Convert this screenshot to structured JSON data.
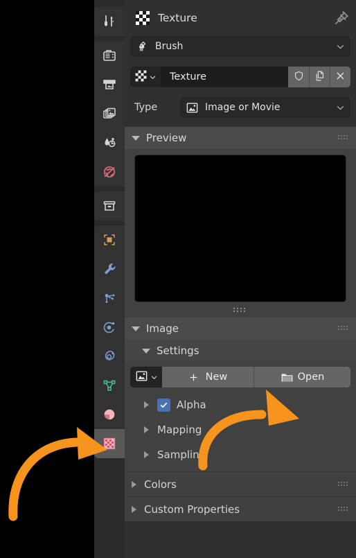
{
  "app": {
    "editor_name": "properties-editor",
    "accent_orange": "#F7941E",
    "panel_bg": "#414141",
    "header_bg": "#4a4a4a",
    "tab_bg": "#323232",
    "tab_active_bg": "#585858",
    "field_bg": "#282828",
    "button_bg": "#656565",
    "checkbox_blue": "#4772b3"
  },
  "tabs": [
    {
      "name": "tool",
      "icon": "tool-icon",
      "color": "#d4d4d4",
      "active": false
    },
    {
      "name": "render",
      "icon": "camera-back-icon",
      "color": "#d4d4d4",
      "active": false
    },
    {
      "name": "output",
      "icon": "printer-icon",
      "color": "#d4d4d4",
      "active": false
    },
    {
      "name": "view-layer",
      "icon": "images-stack-icon",
      "color": "#d4d4d4",
      "active": false
    },
    {
      "name": "scene",
      "icon": "scene-cone-icon",
      "color": "#d4d4d4",
      "active": false
    },
    {
      "name": "world",
      "icon": "world-globe-icon",
      "color": "#d96a7e",
      "active": false
    },
    {
      "name": "collection",
      "icon": "box-icon",
      "color": "#d4d4d4",
      "active": false
    },
    {
      "name": "object",
      "icon": "object-square-icon",
      "color": "#d99b57",
      "active": false
    },
    {
      "name": "modifiers",
      "icon": "wrench-icon",
      "color": "#7d9fd4",
      "active": false
    },
    {
      "name": "particles",
      "icon": "particles-icon",
      "color": "#7d9fd4",
      "active": false
    },
    {
      "name": "physics",
      "icon": "physics-orbit-icon",
      "color": "#7d9fd4",
      "active": false
    },
    {
      "name": "object-constraints",
      "icon": "constraint-icon",
      "color": "#7d9fd4",
      "active": false
    },
    {
      "name": "object-data",
      "icon": "mesh-data-icon",
      "color": "#46c38a",
      "active": false
    },
    {
      "name": "material",
      "icon": "material-sphere-icon",
      "color": "#d9737f",
      "active": false
    },
    {
      "name": "texture",
      "icon": "texture-checker-icon",
      "color": "#e08494",
      "active": true
    }
  ],
  "breadcrumb": {
    "icon": "texture-checker-icon",
    "label": "Texture",
    "pin_icon": "pin-icon"
  },
  "context_selector": {
    "icon": "brush-icon",
    "label": "Brush",
    "chevron": "chevron-down-icon"
  },
  "datablock": {
    "browse_icon": "texture-checker-icon",
    "browse_chevron": "chevron-down-icon",
    "name": "Texture",
    "buttons": [
      {
        "name": "fake-user-button",
        "icon": "shield-icon"
      },
      {
        "name": "new-copy-button",
        "icon": "copy-icon"
      },
      {
        "name": "unlink-button",
        "icon": "close-x-icon"
      }
    ]
  },
  "type_field": {
    "label": "Type",
    "icon": "image-icon",
    "value": "Image or Movie",
    "chevron": "chevron-down-icon"
  },
  "panels": {
    "preview": {
      "title": "Preview",
      "expanded": true,
      "triangle": "triangle-down-icon",
      "grip": "grip-dots-icon",
      "resize_grip": "grip-dots-icon",
      "preview_color": "#000000"
    },
    "image": {
      "title": "Image",
      "expanded": true,
      "triangle": "triangle-down-icon",
      "grip": "grip-dots-icon",
      "settings": {
        "title": "Settings",
        "expanded": true,
        "triangle": "triangle-down-icon"
      },
      "image_bar": {
        "browse_icon": "image-icon",
        "browse_chevron": "chevron-down-icon",
        "new_label": "New",
        "new_icon": "plus-icon",
        "open_label": "Open",
        "open_icon": "folder-icon"
      },
      "sub_items": [
        {
          "name": "alpha",
          "label": "Alpha",
          "triangle": "triangle-right-icon",
          "checkbox": true,
          "checked": true
        },
        {
          "name": "mapping",
          "label": "Mapping",
          "triangle": "triangle-right-icon",
          "checkbox": false
        },
        {
          "name": "sampling",
          "label": "Sampling",
          "triangle": "triangle-right-icon",
          "checkbox": false
        }
      ]
    },
    "colors": {
      "title": "Colors",
      "expanded": false,
      "triangle": "triangle-right-icon",
      "grip": "grip-dots-icon"
    },
    "custom_properties": {
      "title": "Custom Properties",
      "expanded": false,
      "triangle": "triangle-right-icon",
      "grip": "grip-dots-icon"
    }
  },
  "annotations": [
    {
      "name": "arrow-to-texture-tab",
      "color": "#F7941E",
      "points_at": "texture tab"
    },
    {
      "name": "arrow-to-open-button",
      "color": "#F7941E",
      "points_at": "Open button"
    }
  ]
}
